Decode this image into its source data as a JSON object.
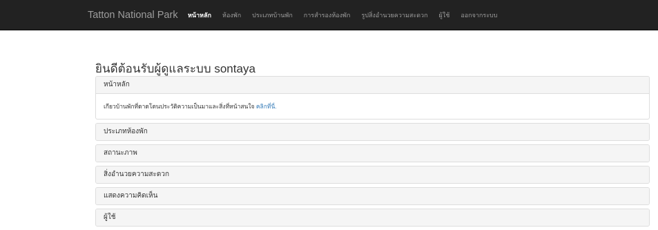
{
  "navbar": {
    "brand": "Tatton National Park",
    "links": [
      {
        "label": "หน้าหลัก",
        "active": true
      },
      {
        "label": "ห้องพัก",
        "active": false
      },
      {
        "label": "ประเภทบ้านพัก",
        "active": false
      },
      {
        "label": "การสำรองห้องพัก",
        "active": false
      },
      {
        "label": "รูปสิ่งอำนวยความสะดวก",
        "active": false
      },
      {
        "label": "ผู้ใช้",
        "active": false
      },
      {
        "label": "ออกจากระบบ",
        "active": false
      }
    ]
  },
  "welcome": "ยินดีต้อนรับผู้ดูแลระบบ sontaya",
  "panels": [
    {
      "title": "หน้าหลัก",
      "body_text": "เกียวบ้านพักที่ดาดโดนประวัติความเป็นมาและสิ่งที่หน้าสนใจ",
      "body_link": "คลิกที่นี่."
    },
    {
      "title": "ประเภทห้องพัก"
    },
    {
      "title": "สถานะภาพ"
    },
    {
      "title": "สิ่งอำนวยความสะดวก"
    },
    {
      "title": "แสดงความคิดเห็น"
    },
    {
      "title": "ผู้ใช้"
    }
  ]
}
